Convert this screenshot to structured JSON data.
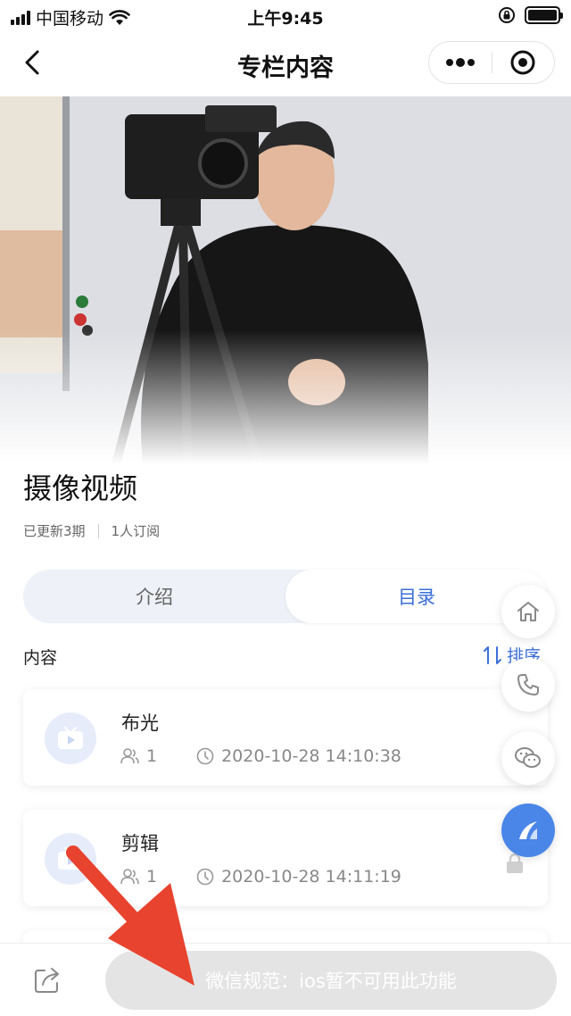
{
  "status_bar": {
    "carrier": "中国移动",
    "time": "上午9:45"
  },
  "nav": {
    "title": "专栏内容"
  },
  "column": {
    "title": "摄像视频",
    "updated": "已更新3期",
    "subscribers": "1人订阅"
  },
  "tabs": [
    {
      "label": "介绍",
      "active": false
    },
    {
      "label": "目录",
      "active": true
    }
  ],
  "section": {
    "label": "内容",
    "sort_label": "排序"
  },
  "items": [
    {
      "name": "布光",
      "views": "1",
      "datetime": "2020-10-28 14:10:38"
    },
    {
      "name": "剪辑",
      "views": "1",
      "datetime": "2020-10-28 14:11:19"
    }
  ],
  "bottom": {
    "notice": "微信规范：ios暂不可用此功能"
  },
  "icons": {
    "back": "chevron-left-icon",
    "more": "more-dots-icon",
    "close": "target-circle-icon",
    "home": "home-icon",
    "phone": "phone-icon",
    "wechat": "wechat-icon",
    "fab_logo": "logo-icon",
    "share": "share-icon",
    "video": "video-icon",
    "people": "people-icon",
    "clock": "clock-icon",
    "lock": "lock-icon"
  },
  "colors": {
    "accent": "#3b6fd8",
    "tab_bg": "#eef1f7",
    "disabled_button": "#e4e4e4",
    "annotation_arrow": "#e8432e",
    "fab_blue": "#4a86e8"
  }
}
